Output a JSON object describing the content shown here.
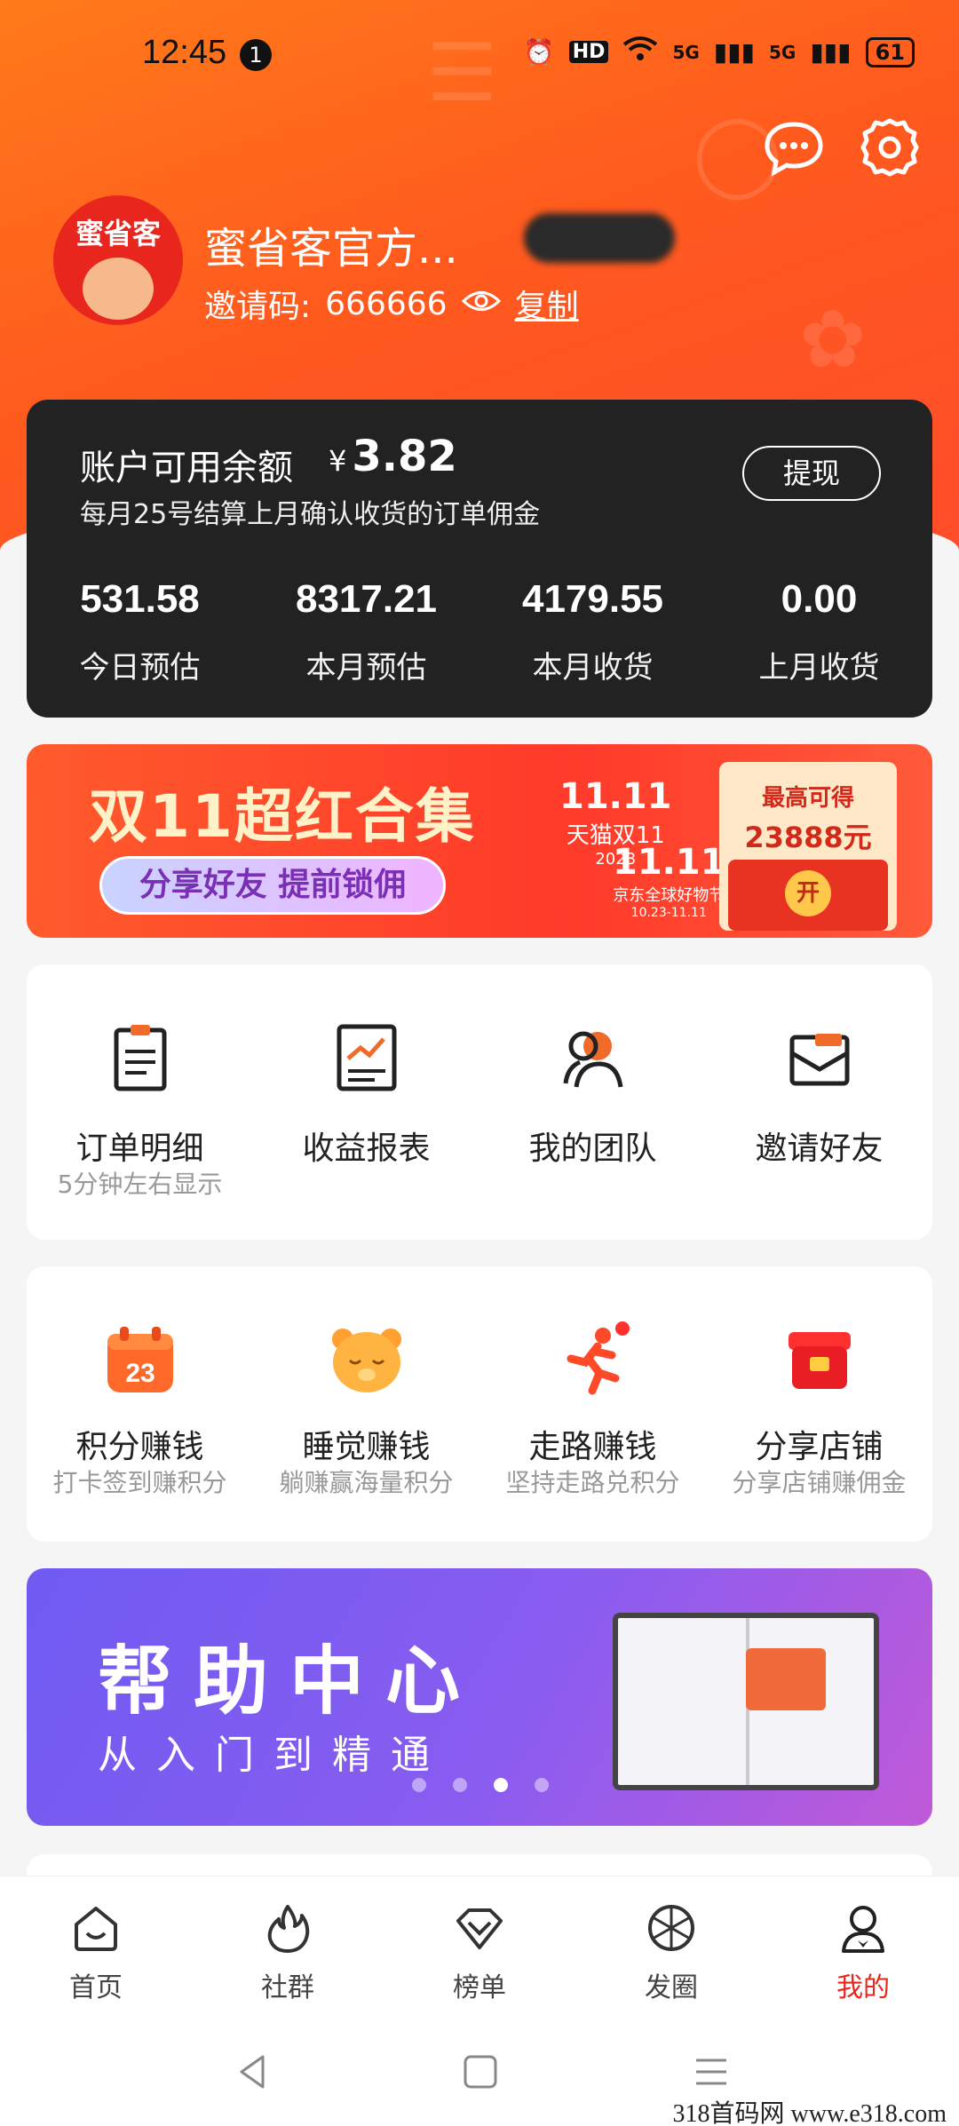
{
  "status_bar": {
    "time": "12:45",
    "notif_count": "1",
    "hd_label": "HD",
    "net1": "5G",
    "net2": "5G",
    "battery": "61"
  },
  "header": {
    "icons": [
      "message-icon",
      "settings-icon"
    ]
  },
  "profile": {
    "avatar_text": "蜜省客",
    "name": "蜜省客官方...",
    "invite_label": "邀请码:",
    "invite_code": "666666",
    "copy_label": "复制"
  },
  "balance": {
    "label": "账户可用余额",
    "currency": "¥",
    "amount": "3.82",
    "note": "每月25号结算上月确认收货的订单佣金",
    "withdraw_label": "提现",
    "stats": [
      {
        "value": "531.58",
        "label": "今日预估"
      },
      {
        "value": "8317.21",
        "label": "本月预估"
      },
      {
        "value": "4179.55",
        "label": "本月收货"
      },
      {
        "value": "0.00",
        "label": "上月收货"
      }
    ]
  },
  "promo": {
    "title": "双11超红合集",
    "pill": "分享好友 提前锁佣",
    "tmall": "天猫双11",
    "tmall_year": "2023",
    "jd_label": "京东全球好物节",
    "jd_dates": "10.23-11.11",
    "red_top": "最高可得",
    "red_amount": "23888元",
    "open": "开"
  },
  "tools": [
    {
      "title": "订单明细",
      "sub": "5分钟左右显示",
      "icon": "order-list-icon"
    },
    {
      "title": "收益报表",
      "sub": "",
      "icon": "earnings-report-icon"
    },
    {
      "title": "我的团队",
      "sub": "",
      "icon": "team-icon"
    },
    {
      "title": "邀请好友",
      "sub": "",
      "icon": "invite-envelope-icon"
    }
  ],
  "earn": [
    {
      "title": "积分赚钱",
      "sub": "打卡签到赚积分",
      "icon": "calendar-icon",
      "badge": "23"
    },
    {
      "title": "睡觉赚钱",
      "sub": "躺赚赢海量积分",
      "icon": "sleeping-bear-icon"
    },
    {
      "title": "走路赚钱",
      "sub": "坚持走路兑积分",
      "icon": "runner-icon"
    },
    {
      "title": "分享店铺",
      "sub": "分享店铺赚佣金",
      "icon": "store-icon"
    }
  ],
  "help": {
    "title": "帮助中心",
    "subtitle": "从入门到精通",
    "active_dot": 2,
    "dot_count": 4
  },
  "nav": [
    {
      "label": "首页",
      "icon": "home-icon"
    },
    {
      "label": "社群",
      "icon": "flame-icon"
    },
    {
      "label": "榜单",
      "icon": "ranking-icon"
    },
    {
      "label": "发圈",
      "icon": "aperture-icon"
    },
    {
      "label": "我的",
      "icon": "profile-icon",
      "active": true
    }
  ],
  "colors": {
    "accent": "#ff5a1e",
    "active_nav": "#e8261e",
    "card_dark": "#222222"
  },
  "watermark": "318首码网  www.e318.com"
}
